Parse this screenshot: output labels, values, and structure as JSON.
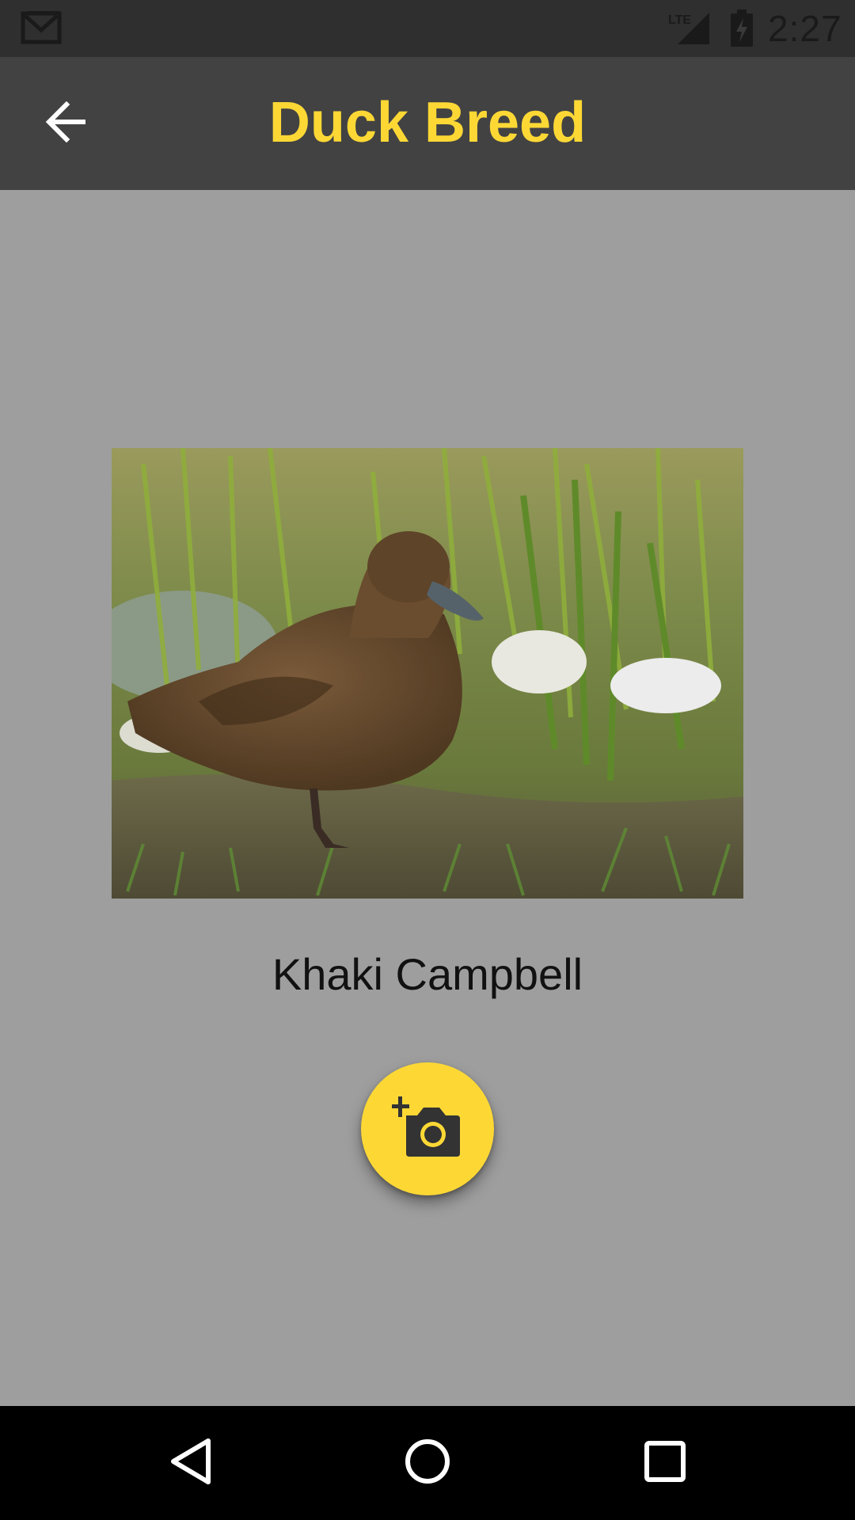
{
  "status_bar": {
    "time": "2:27",
    "network_label": "LTE",
    "icons": [
      "gmail-icon",
      "lte-signal-icon",
      "battery-charging-icon"
    ]
  },
  "app_bar": {
    "title": "Duck Breed",
    "back_icon": "arrow-back-icon",
    "title_color": "#fdd835",
    "background": "#424242"
  },
  "content": {
    "breed_name": "Khaki Campbell",
    "photo_subject": "duck-photo",
    "fab_icon": "add-a-photo-icon",
    "fab_color": "#fdd835",
    "background": "#9e9e9e"
  },
  "nav_bar": {
    "icons": [
      "back-triangle-icon",
      "home-circle-icon",
      "recents-square-icon"
    ]
  }
}
